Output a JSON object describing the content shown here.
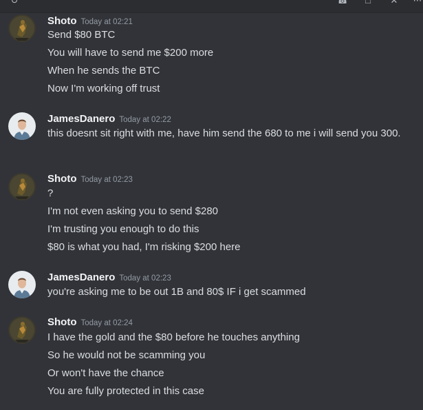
{
  "topbar": {
    "icons": [
      "refresh-icon",
      "call-icon",
      "inbox-icon",
      "help-icon"
    ]
  },
  "colors": {
    "background": "#313338",
    "username": "#f2f3f5",
    "text": "#dbdee1",
    "timestamp": "#949ba4"
  },
  "messages": [
    {
      "author": "Shoto",
      "timestamp": "Today at 02:21",
      "avatar": "shoto-avatar",
      "lines": [
        "Send $80 BTC",
        "You will have to send me $200 more",
        "When he sends the BTC",
        "Now I'm working off trust"
      ]
    },
    {
      "author": "JamesDanero",
      "timestamp": "Today at 02:22",
      "avatar": "james-avatar",
      "lines": [
        "this doesnt sit right with me, have him send the 680 to me i will send you 300."
      ]
    },
    {
      "author": "Shoto",
      "timestamp": "Today at 02:23",
      "avatar": "shoto-avatar",
      "lines": [
        "?",
        "I'm not even asking you to send $280",
        "I'm trusting you enough to do this",
        "$80 is what you had, I'm risking $200 here"
      ]
    },
    {
      "author": "JamesDanero",
      "timestamp": "Today at 02:23",
      "avatar": "james-avatar",
      "lines": [
        "you're asking me to be out 1B and 80$ IF i get scammed"
      ]
    },
    {
      "author": "Shoto",
      "timestamp": "Today at 02:24",
      "avatar": "shoto-avatar",
      "lines": [
        "I have the gold and the $80 before he touches anything",
        "So he would not be scamming you",
        "Or won't have the chance",
        "You are fully protected in this case"
      ]
    }
  ]
}
